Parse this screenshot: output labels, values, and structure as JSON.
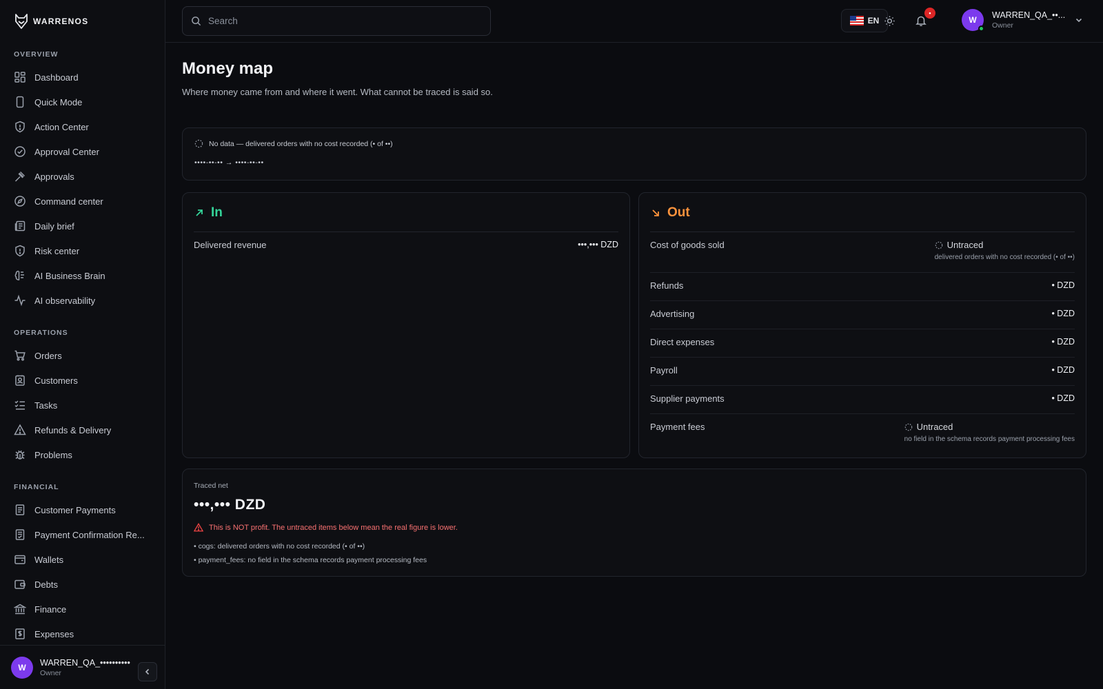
{
  "brand": {
    "name": "WARRENOS"
  },
  "sidebar": {
    "sections": [
      {
        "label": "OVERVIEW",
        "items": [
          {
            "label": "Dashboard",
            "icon": "dashboard-icon"
          },
          {
            "label": "Quick Mode",
            "icon": "phone-icon"
          },
          {
            "label": "Action Center",
            "icon": "shield-icon"
          },
          {
            "label": "Approval Center",
            "icon": "check-circle-icon"
          },
          {
            "label": "Approvals",
            "icon": "gavel-icon"
          },
          {
            "label": "Command center",
            "icon": "compass-icon"
          },
          {
            "label": "Daily brief",
            "icon": "newspaper-icon"
          },
          {
            "label": "Risk center",
            "icon": "shield-icon"
          },
          {
            "label": "AI Business Brain",
            "icon": "brain-icon"
          },
          {
            "label": "AI observability",
            "icon": "activity-icon"
          }
        ]
      },
      {
        "label": "OPERATIONS",
        "items": [
          {
            "label": "Orders",
            "icon": "cart-icon"
          },
          {
            "label": "Customers",
            "icon": "contact-icon"
          },
          {
            "label": "Tasks",
            "icon": "list-check-icon"
          },
          {
            "label": "Refunds & Delivery",
            "icon": "warning-icon"
          },
          {
            "label": "Problems",
            "icon": "bug-icon"
          }
        ]
      },
      {
        "label": "FINANCIAL",
        "items": [
          {
            "label": "Customer Payments",
            "icon": "receipt-icon"
          },
          {
            "label": "Payment Confirmation Re...",
            "icon": "receipt-check-icon"
          },
          {
            "label": "Wallets",
            "icon": "wallet-icon"
          },
          {
            "label": "Debts",
            "icon": "debt-wallet-icon"
          },
          {
            "label": "Finance",
            "icon": "bank-icon"
          },
          {
            "label": "Expenses",
            "icon": "dollar-receipt-icon"
          }
        ]
      }
    ],
    "user": {
      "initial": "W",
      "name": "WARREN_QA_••••••••••",
      "role": "Owner"
    }
  },
  "topbar": {
    "search_placeholder": "Search",
    "language": "EN",
    "notification_count": "•",
    "user": {
      "initial": "W",
      "name": "WARREN_QA_••...",
      "role": "Owner"
    }
  },
  "page": {
    "title": "Money map",
    "subtitle": "Where money came from and where it went. What cannot be traced is said so."
  },
  "status": {
    "text": "No data — delivered orders with no cost recorded (• of ••)",
    "range": "••••-••-•• → ••••-••-••"
  },
  "in_card": {
    "title": "In",
    "rows": [
      {
        "label": "Delivered revenue",
        "value": "•••,••• DZD"
      }
    ]
  },
  "out_card": {
    "title": "Out",
    "cogs": {
      "label": "Cost of goods sold",
      "status": "Untraced",
      "note": "delivered orders with no cost recorded (• of ••)"
    },
    "rows": [
      {
        "label": "Refunds",
        "value": "• DZD"
      },
      {
        "label": "Advertising",
        "value": "• DZD"
      },
      {
        "label": "Direct expenses",
        "value": "• DZD"
      },
      {
        "label": "Payroll",
        "value": "• DZD"
      },
      {
        "label": "Supplier payments",
        "value": "• DZD"
      }
    ],
    "fees": {
      "label": "Payment fees",
      "status": "Untraced",
      "note": "no field in the schema records payment processing fees"
    }
  },
  "net": {
    "label": "Traced net",
    "value": "•••,••• DZD",
    "warning": "This is NOT profit. The untraced items below mean the real figure is lower.",
    "items": [
      "• cogs: delivered orders with no cost recorded (• of ••)",
      "• payment_fees: no field in the schema records payment processing fees"
    ]
  },
  "colors": {
    "in_accent": "#34d399",
    "out_accent": "#fb923c",
    "warning": "#f87171",
    "avatar": "#7c3aed",
    "badge": "#dc2626",
    "background": "#0b0c10"
  }
}
